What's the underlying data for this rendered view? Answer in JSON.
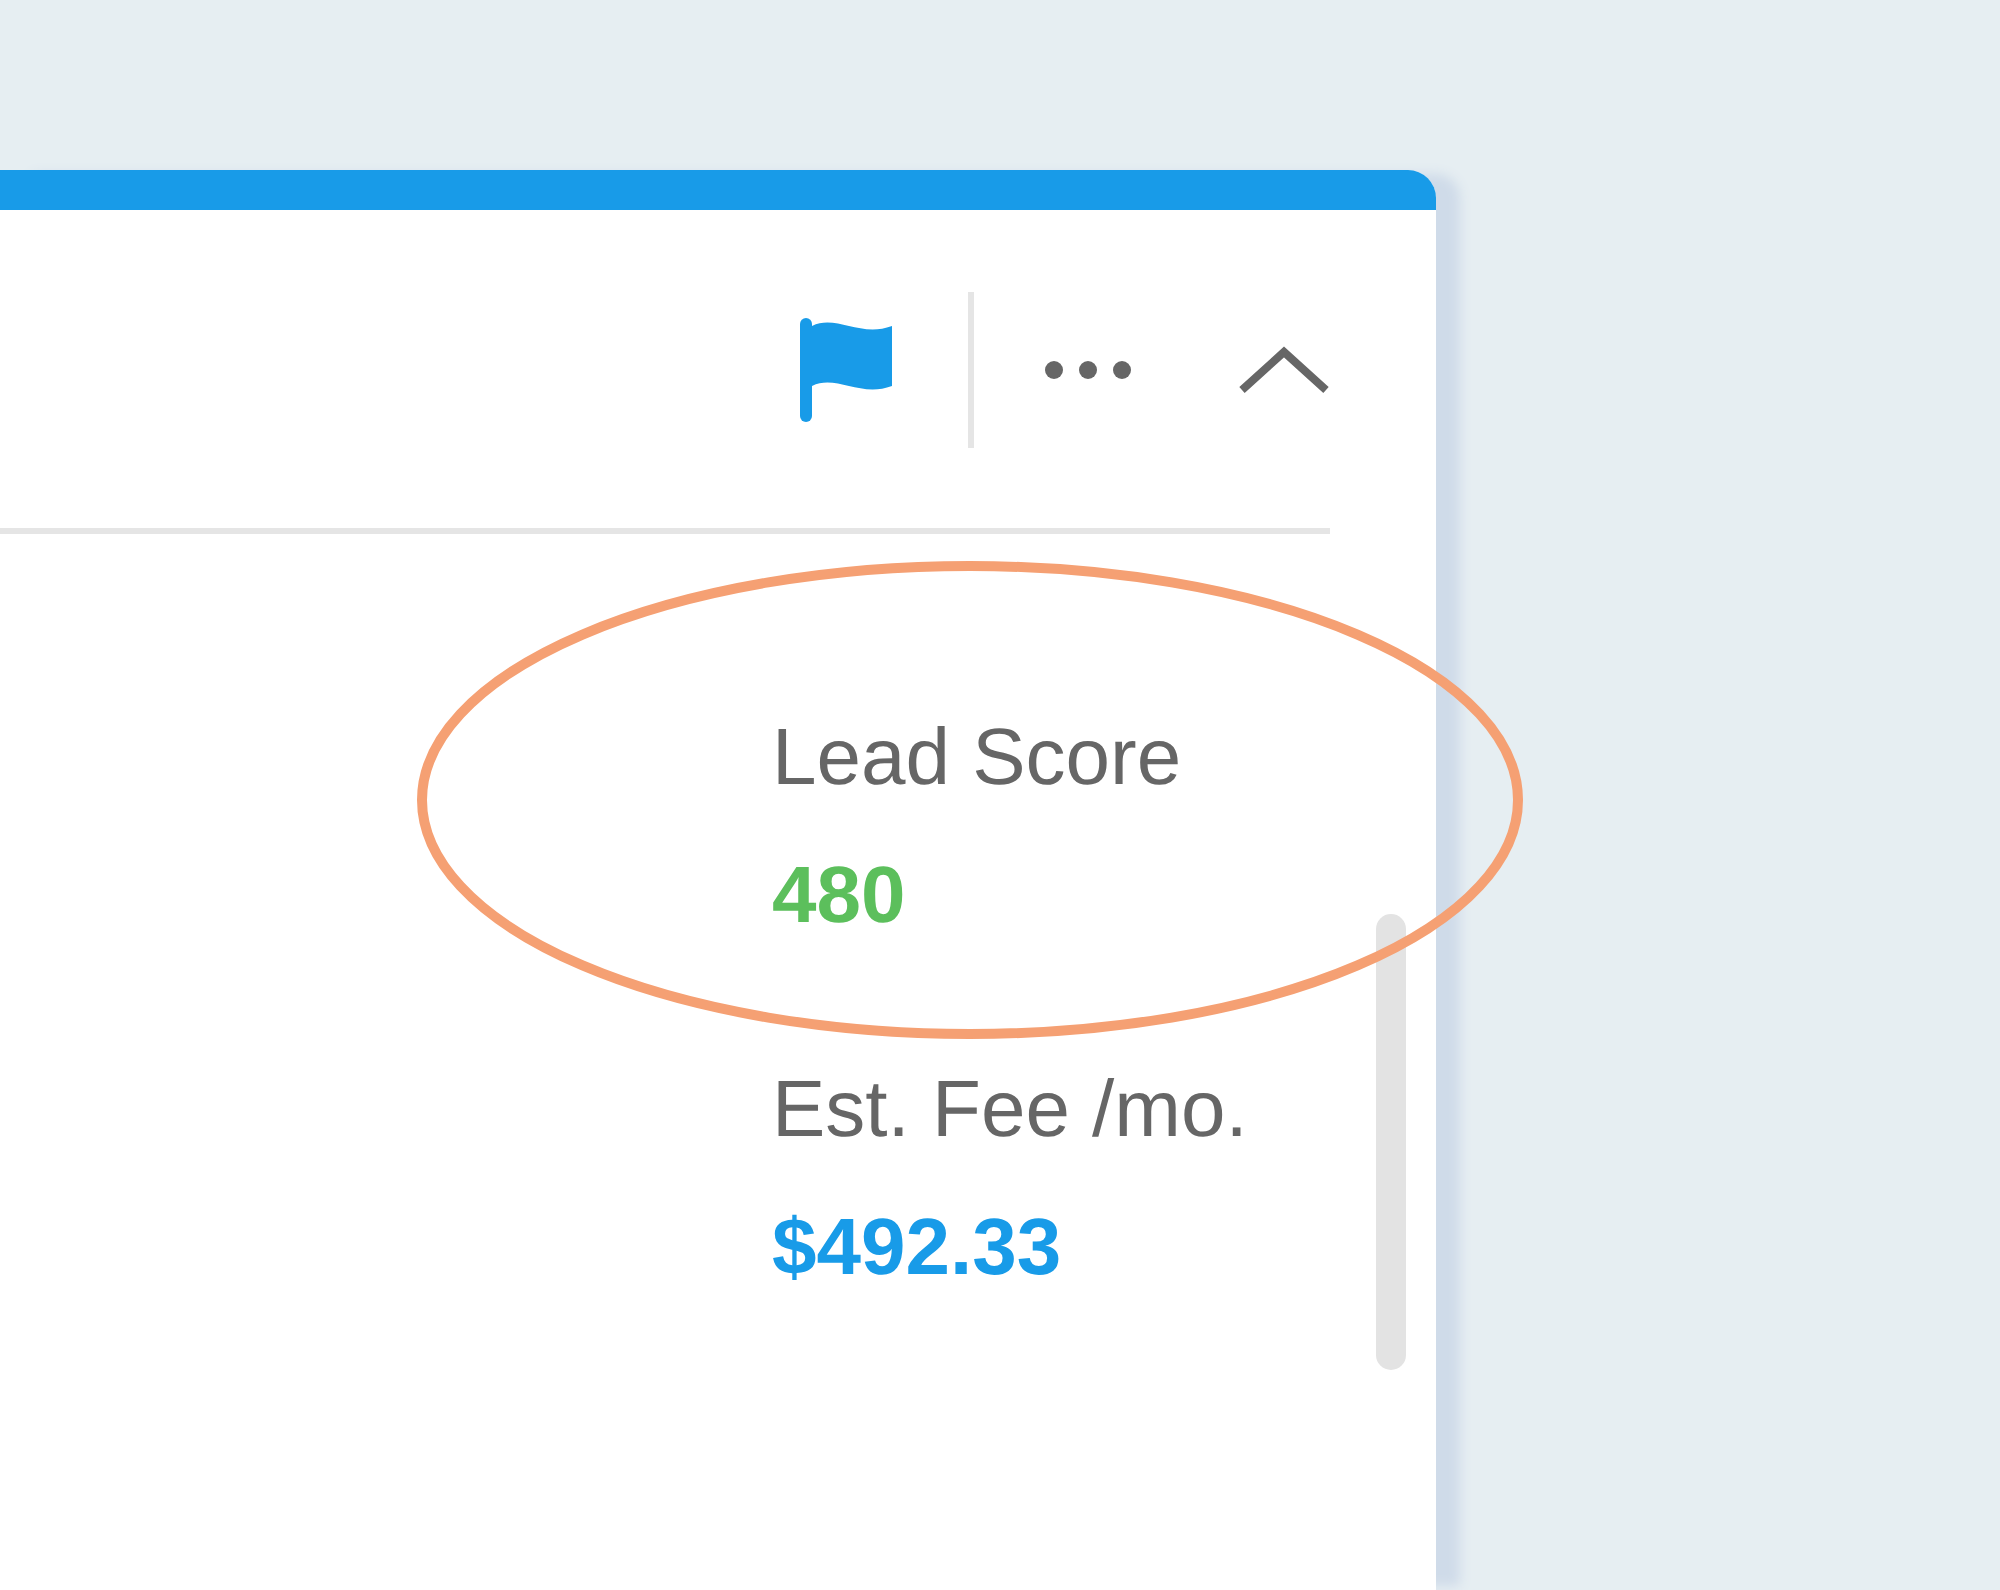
{
  "header": {
    "flagged": true
  },
  "metrics": [
    {
      "label": "Lead Score",
      "value": "480",
      "color": "#5cbf5c",
      "kind": "circled"
    },
    {
      "label": "Est. Fee /mo.",
      "value": "$492.33",
      "color": "#189be8",
      "kind": "plain"
    }
  ]
}
